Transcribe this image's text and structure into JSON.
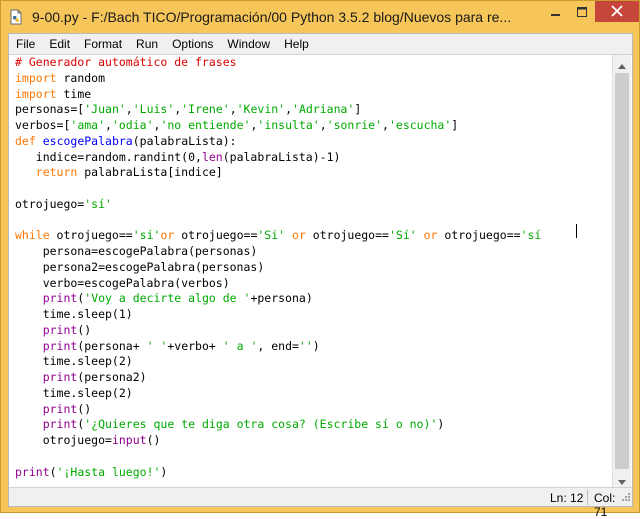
{
  "window": {
    "title": "9-00.py - F:/Bach TICO/Programación/00 Python 3.5.2 blog/Nuevos para re..."
  },
  "icons": {
    "app": "python-file-icon",
    "minimize": "minimize-icon",
    "maximize": "maximize-icon",
    "close": "close-icon"
  },
  "menu": [
    {
      "label": "File"
    },
    {
      "label": "Edit"
    },
    {
      "label": "Format"
    },
    {
      "label": "Run"
    },
    {
      "label": "Options"
    },
    {
      "label": "Window"
    },
    {
      "label": "Help"
    }
  ],
  "colors": {
    "titlebar": "#f7c65a",
    "close_button": "#c7463a",
    "comment": "#dd0000",
    "keyword": "#ff7700",
    "builtin": "#900090",
    "string": "#00aa00",
    "definition": "#0000ff"
  },
  "code_lines": [
    [
      {
        "t": "comment",
        "s": "# Generador automático de frases"
      }
    ],
    [
      {
        "t": "keyword",
        "s": "import"
      },
      {
        "t": "plain",
        "s": " random"
      }
    ],
    [
      {
        "t": "keyword",
        "s": "import"
      },
      {
        "t": "plain",
        "s": " time"
      }
    ],
    [
      {
        "t": "plain",
        "s": "personas=["
      },
      {
        "t": "string",
        "s": "'Juan'"
      },
      {
        "t": "plain",
        "s": ","
      },
      {
        "t": "string",
        "s": "'Luis'"
      },
      {
        "t": "plain",
        "s": ","
      },
      {
        "t": "string",
        "s": "'Irene'"
      },
      {
        "t": "plain",
        "s": ","
      },
      {
        "t": "string",
        "s": "'Kevin'"
      },
      {
        "t": "plain",
        "s": ","
      },
      {
        "t": "string",
        "s": "'Adriana'"
      },
      {
        "t": "plain",
        "s": "]"
      }
    ],
    [
      {
        "t": "plain",
        "s": "verbos=["
      },
      {
        "t": "string",
        "s": "'ama'"
      },
      {
        "t": "plain",
        "s": ","
      },
      {
        "t": "string",
        "s": "'odia'"
      },
      {
        "t": "plain",
        "s": ","
      },
      {
        "t": "string",
        "s": "'no entiende'"
      },
      {
        "t": "plain",
        "s": ","
      },
      {
        "t": "string",
        "s": "'insulta'"
      },
      {
        "t": "plain",
        "s": ","
      },
      {
        "t": "string",
        "s": "'sonrie'"
      },
      {
        "t": "plain",
        "s": ","
      },
      {
        "t": "string",
        "s": "'escucha'"
      },
      {
        "t": "plain",
        "s": "]"
      }
    ],
    [
      {
        "t": "keyword",
        "s": "def"
      },
      {
        "t": "plain",
        "s": " "
      },
      {
        "t": "def",
        "s": "escogePalabra"
      },
      {
        "t": "plain",
        "s": "(palabraLista):"
      }
    ],
    [
      {
        "t": "plain",
        "s": "   indice=random.randint(0,"
      },
      {
        "t": "builtin",
        "s": "len"
      },
      {
        "t": "plain",
        "s": "(palabraLista)-1)"
      }
    ],
    [
      {
        "t": "plain",
        "s": "   "
      },
      {
        "t": "keyword",
        "s": "return"
      },
      {
        "t": "plain",
        "s": " palabraLista[indice]"
      }
    ],
    [
      {
        "t": "plain",
        "s": ""
      }
    ],
    [
      {
        "t": "plain",
        "s": "otrojuego="
      },
      {
        "t": "string",
        "s": "'sí'"
      }
    ],
    [
      {
        "t": "plain",
        "s": ""
      }
    ],
    [
      {
        "t": "keyword",
        "s": "while"
      },
      {
        "t": "plain",
        "s": " otrojuego=="
      },
      {
        "t": "string",
        "s": "'si'"
      },
      {
        "t": "keyword",
        "s": "or"
      },
      {
        "t": "plain",
        "s": " otrojuego=="
      },
      {
        "t": "string",
        "s": "'Si'"
      },
      {
        "t": "plain",
        "s": " "
      },
      {
        "t": "keyword",
        "s": "or"
      },
      {
        "t": "plain",
        "s": " otrojuego=="
      },
      {
        "t": "string",
        "s": "'Sí'"
      },
      {
        "t": "plain",
        "s": " "
      },
      {
        "t": "keyword",
        "s": "or"
      },
      {
        "t": "plain",
        "s": " otrojuego=="
      },
      {
        "t": "string",
        "s": "'sí"
      }
    ],
    [
      {
        "t": "plain",
        "s": "    persona=escogePalabra(personas)"
      }
    ],
    [
      {
        "t": "plain",
        "s": "    persona2=escogePalabra(personas)"
      }
    ],
    [
      {
        "t": "plain",
        "s": "    verbo=escogePalabra(verbos)"
      }
    ],
    [
      {
        "t": "plain",
        "s": "    "
      },
      {
        "t": "builtin",
        "s": "print"
      },
      {
        "t": "plain",
        "s": "("
      },
      {
        "t": "string",
        "s": "'Voy a decirte algo de '"
      },
      {
        "t": "plain",
        "s": "+persona)"
      }
    ],
    [
      {
        "t": "plain",
        "s": "    time.sleep(1)"
      }
    ],
    [
      {
        "t": "plain",
        "s": "    "
      },
      {
        "t": "builtin",
        "s": "print"
      },
      {
        "t": "plain",
        "s": "()"
      }
    ],
    [
      {
        "t": "plain",
        "s": "    "
      },
      {
        "t": "builtin",
        "s": "print"
      },
      {
        "t": "plain",
        "s": "(persona+ "
      },
      {
        "t": "string",
        "s": "' '"
      },
      {
        "t": "plain",
        "s": "+verbo+ "
      },
      {
        "t": "string",
        "s": "' a '"
      },
      {
        "t": "plain",
        "s": ", end="
      },
      {
        "t": "string",
        "s": "''"
      },
      {
        "t": "plain",
        "s": ")"
      }
    ],
    [
      {
        "t": "plain",
        "s": "    time.sleep(2)"
      }
    ],
    [
      {
        "t": "plain",
        "s": "    "
      },
      {
        "t": "builtin",
        "s": "print"
      },
      {
        "t": "plain",
        "s": "(persona2)"
      }
    ],
    [
      {
        "t": "plain",
        "s": "    time.sleep(2)"
      }
    ],
    [
      {
        "t": "plain",
        "s": "    "
      },
      {
        "t": "builtin",
        "s": "print"
      },
      {
        "t": "plain",
        "s": "()"
      }
    ],
    [
      {
        "t": "plain",
        "s": "    "
      },
      {
        "t": "builtin",
        "s": "print"
      },
      {
        "t": "plain",
        "s": "("
      },
      {
        "t": "string",
        "s": "'¿Quieres que te diga otra cosa? (Escribe sí o no)'"
      },
      {
        "t": "plain",
        "s": ")"
      }
    ],
    [
      {
        "t": "plain",
        "s": "    otrojuego="
      },
      {
        "t": "builtin",
        "s": "input"
      },
      {
        "t": "plain",
        "s": "()"
      }
    ],
    [
      {
        "t": "plain",
        "s": ""
      }
    ],
    [
      {
        "t": "builtin",
        "s": "print"
      },
      {
        "t": "plain",
        "s": "("
      },
      {
        "t": "string",
        "s": "'¡Hasta luego!'"
      },
      {
        "t": "plain",
        "s": ")"
      }
    ]
  ],
  "status": {
    "line": "Ln: 12",
    "col": "Col: 71"
  }
}
